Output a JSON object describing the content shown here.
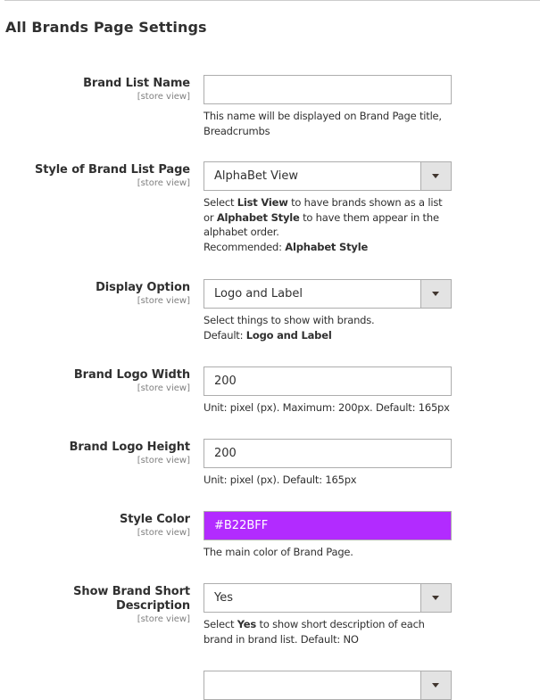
{
  "section": {
    "title": "All Brands Page Settings"
  },
  "scope_label": "[store view]",
  "fields": {
    "brand_list_name": {
      "label": "Brand List Name",
      "value": "",
      "note": "This name will be displayed on Brand Page title, Breadcrumbs"
    },
    "style_of_brand_list_page": {
      "label": "Style of Brand List Page",
      "selected": "AlphaBet View",
      "note_parts": {
        "p1": "Select ",
        "b1": "List View",
        "p2": " to have brands shown as a list or ",
        "b2": "Alphabet Style",
        "p3": " to have them appear in the alphabet order.",
        "p4": "Recommended: ",
        "b3": "Alphabet Style"
      }
    },
    "display_option": {
      "label": "Display Option",
      "selected": "Logo and Label",
      "note_parts": {
        "p1": "Select things to show with brands.",
        "p2": "Default: ",
        "b1": "Logo and Label"
      }
    },
    "brand_logo_width": {
      "label": "Brand Logo Width",
      "value": "200",
      "note": "Unit: pixel (px). Maximum: 200px. Default: 165px"
    },
    "brand_logo_height": {
      "label": "Brand Logo Height",
      "value": "200",
      "note": "Unit: pixel (px). Default: 165px"
    },
    "style_color": {
      "label": "Style Color",
      "value": "#B22BFF",
      "swatch_color": "#B22BFF",
      "note": "The main color of Brand Page."
    },
    "show_brand_short_description": {
      "label": "Show Brand Short Description",
      "selected": "Yes",
      "note_parts": {
        "p1": "Select ",
        "b1": "Yes",
        "p2": " to show short description of each brand in brand list. Default: NO"
      }
    }
  }
}
